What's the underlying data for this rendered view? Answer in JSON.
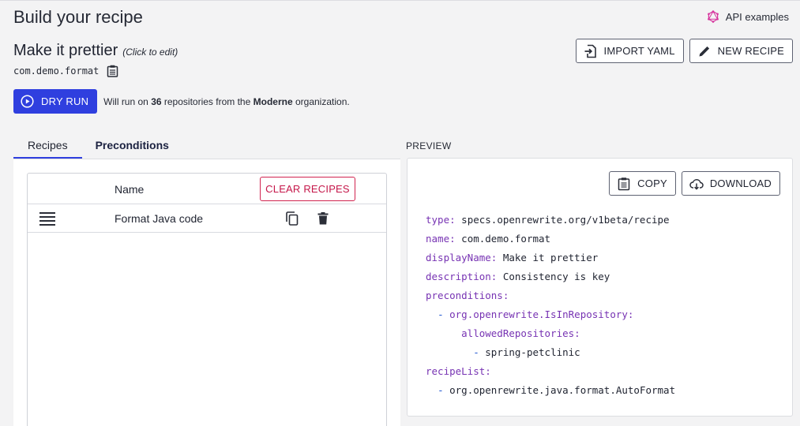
{
  "page": {
    "title": "Build your recipe",
    "api_examples": "API examples"
  },
  "recipe": {
    "title": "Make it prettier",
    "click_to_edit": "(Click to edit)",
    "id": "com.demo.format"
  },
  "actions": {
    "import_yaml": "IMPORT YAML",
    "new_recipe": "NEW RECIPE"
  },
  "dry_run": {
    "label": "DRY RUN",
    "note_prefix": "Will run on",
    "count": "36",
    "note_middle": "repositories from the",
    "org": "Moderne",
    "note_suffix": "organization."
  },
  "tabs": [
    {
      "label": "Recipes"
    },
    {
      "label": "Preconditions"
    }
  ],
  "recipes_table": {
    "col_name": "Name",
    "clear_label": "CLEAR RECIPES",
    "rows": [
      {
        "name": "Format Java code"
      }
    ]
  },
  "preview": {
    "label": "PREVIEW",
    "copy_label": "COPY",
    "download_label": "DOWNLOAD",
    "yaml": [
      {
        "indent": "",
        "dash": "",
        "key": "type:",
        "value": " specs.openrewrite.org/v1beta/recipe"
      },
      {
        "indent": "",
        "dash": "",
        "key": "name:",
        "value": " com.demo.format"
      },
      {
        "indent": "",
        "dash": "",
        "key": "displayName:",
        "value": " Make it prettier"
      },
      {
        "indent": "",
        "dash": "",
        "key": "description:",
        "value": " Consistency is key"
      },
      {
        "indent": "",
        "dash": "",
        "key": "preconditions:",
        "value": ""
      },
      {
        "indent": "  ",
        "dash": "- ",
        "key": "org.openrewrite.IsInRepository:",
        "value": ""
      },
      {
        "indent": "      ",
        "dash": "",
        "key": "allowedRepositories:",
        "value": ""
      },
      {
        "indent": "        ",
        "dash": "- ",
        "key": "",
        "value": "spring-petclinic"
      },
      {
        "indent": "",
        "dash": "",
        "key": "recipeList:",
        "value": ""
      },
      {
        "indent": "  ",
        "dash": "- ",
        "key": "",
        "value": "org.openrewrite.java.format.AutoFormat"
      }
    ]
  }
}
